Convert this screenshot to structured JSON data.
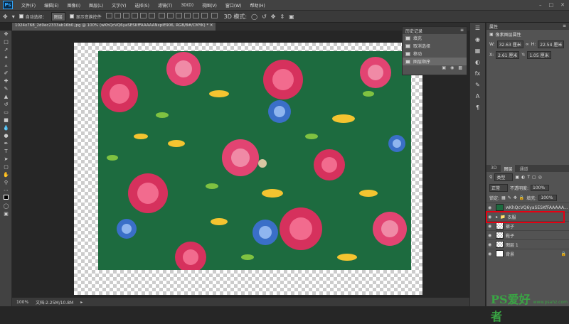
{
  "app": {
    "logo": "Ps"
  },
  "menubar": {
    "items": [
      "文件(F)",
      "编辑(E)",
      "图像(I)",
      "图层(L)",
      "文字(Y)",
      "选择(S)",
      "滤镜(T)",
      "3D(D)",
      "视图(V)",
      "窗口(W)",
      "帮助(H)"
    ]
  },
  "options": {
    "auto_select_label": "自动选择：",
    "auto_select_value": "图层",
    "show_transform_label": "显示变换控件"
  },
  "document": {
    "tab_title": "1024x768_2d0ec2333ab16b0.jpg @ 100% (wKhQcVQ6yaSESKfFAAAAANxpiE906, RGB/8#/CMYK) *"
  },
  "status": {
    "zoom": "100%",
    "doc_size": "文档:2.25M/10.8M"
  },
  "history": {
    "title": "历史记录",
    "items": [
      {
        "label": "填充",
        "active": false
      },
      {
        "label": "取消选择",
        "active": false
      },
      {
        "label": "移动",
        "active": false
      },
      {
        "label": "图层顺序",
        "active": true
      }
    ]
  },
  "properties": {
    "title": "属性",
    "subtitle": "像素图层属性",
    "w_label": "W:",
    "w_value": "32.63 厘米",
    "h_label": "H:",
    "h_value": "22.54 厘米",
    "x_label": "X:",
    "x_value": "2.61 厘米",
    "y_label": "Y:",
    "y_value": "1.05 厘米"
  },
  "layers": {
    "tabs": [
      "3D",
      "图层",
      "通道"
    ],
    "active_tab": 1,
    "filter_kind": "类型",
    "blend_mode": "正常",
    "opacity_label": "不透明度:",
    "opacity_value": "100%",
    "lock_label": "锁定:",
    "fill_label": "填充:",
    "fill_value": "100%",
    "rows": [
      {
        "name": "wKhQcVQ6yaSESKfFAAAAA...",
        "visible": true,
        "selected": false
      },
      {
        "name": "衣服",
        "visible": true,
        "selected": false,
        "group": true
      },
      {
        "name": "裤子",
        "visible": true,
        "selected": false
      },
      {
        "name": "鞋子",
        "visible": true,
        "selected": false
      },
      {
        "name": "图层 1",
        "visible": true,
        "selected": false
      },
      {
        "name": "背景",
        "visible": true,
        "selected": false
      }
    ]
  },
  "watermark": {
    "main": "PS爱好者",
    "sub": "www.psahz.com"
  },
  "colors": {
    "accent": "#31a8ff",
    "highlight": "#e60012",
    "fabric": "#1d6b3f"
  }
}
